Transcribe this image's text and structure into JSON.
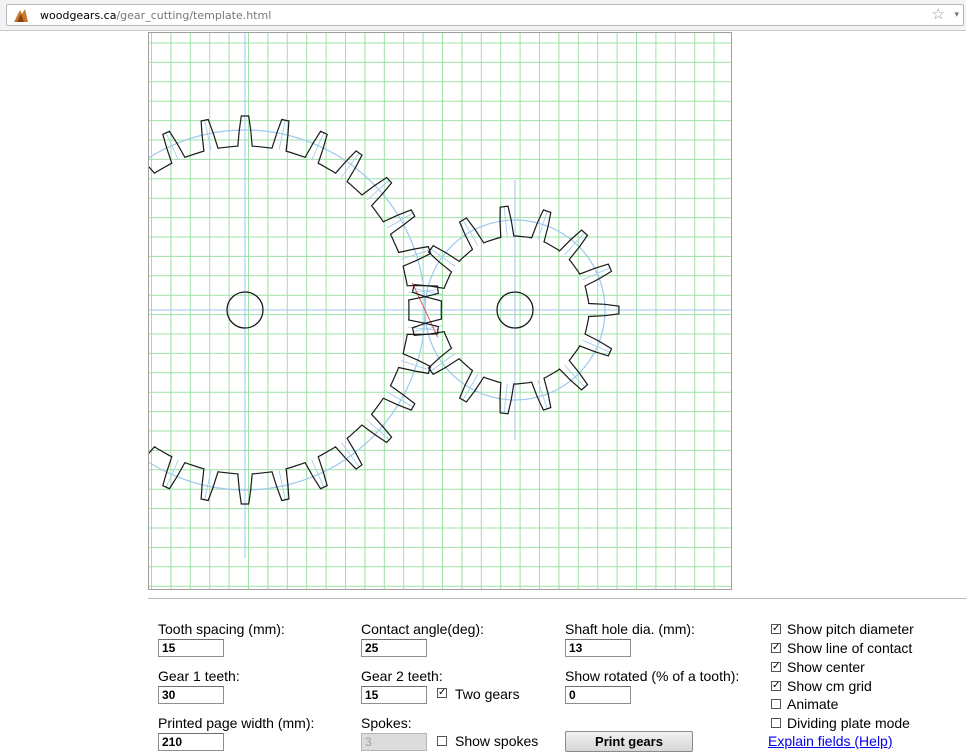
{
  "browser": {
    "url_domain": "woodgears.ca",
    "url_path": "/gear_cutting/template.html"
  },
  "controls": {
    "tooth_spacing": {
      "label": "Tooth spacing (mm):",
      "value": "15"
    },
    "gear1_teeth": {
      "label": "Gear 1 teeth:",
      "value": "30"
    },
    "page_width": {
      "label": "Printed page width (mm):",
      "value": "210"
    },
    "contact_angle": {
      "label": "Contact angle(deg):",
      "value": "25"
    },
    "gear2_teeth": {
      "label": "Gear 2 teeth:",
      "value": "15"
    },
    "two_gears": {
      "label": "Two gears",
      "checked": true
    },
    "spokes": {
      "label": "Spokes:",
      "value": "3"
    },
    "show_spokes": {
      "label": "Show spokes",
      "checked": false
    },
    "shaft_hole": {
      "label": "Shaft hole dia. (mm):",
      "value": "13"
    },
    "show_rotated": {
      "label": "Show rotated (% of a tooth):",
      "value": "0"
    },
    "print_button": "Print gears",
    "options": [
      {
        "label": "Show pitch diameter",
        "checked": true
      },
      {
        "label": "Show line of contact",
        "checked": true
      },
      {
        "label": "Show center",
        "checked": true
      },
      {
        "label": "Show cm grid",
        "checked": true
      },
      {
        "label": "Animate",
        "checked": false
      },
      {
        "label": "Dividing plate mode",
        "checked": false
      }
    ],
    "help_link": "Explain fields (Help)"
  },
  "colors": {
    "grid": "#9fe0a4",
    "gear_outline": "#1a1a1a",
    "pitch_circle": "#9ec9ee",
    "contact_line": "#e05555"
  }
}
